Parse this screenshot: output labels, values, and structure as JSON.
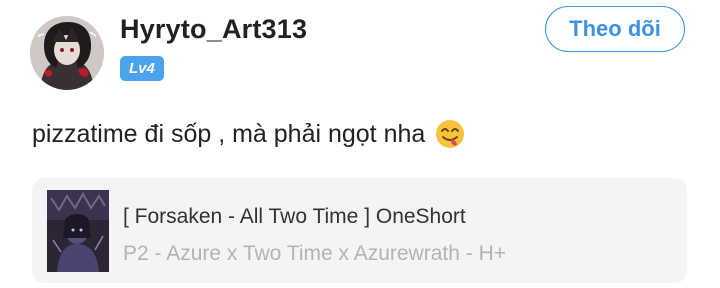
{
  "header": {
    "username": "Hyryto_Art313",
    "level": "Lv4",
    "follow_label": "Theo dõi"
  },
  "post": {
    "text": "pizzatime đi sốp , mà phải ngọt nha",
    "emoji": "yum-face-emoji"
  },
  "story_card": {
    "title": "[ Forsaken - All Two Time ] OneShort",
    "subtitle": "P2 - Azure x Two Time x Azurewrath - H+"
  },
  "colors": {
    "accent": "#3d93df",
    "badge": "#4aa3ec",
    "card_bg": "#f4f4f5",
    "text": "#222222",
    "muted_text": "#b3b3b3"
  }
}
